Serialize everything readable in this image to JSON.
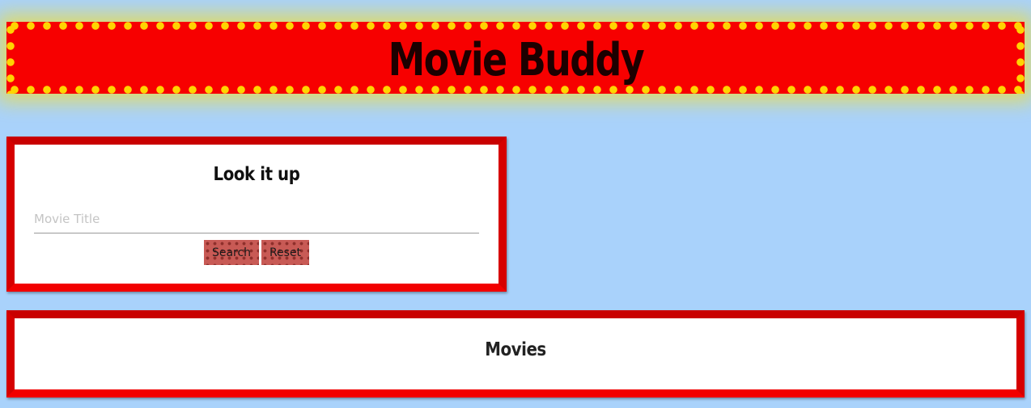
{
  "header": {
    "title": "Movie Buddy"
  },
  "search": {
    "heading": "Look it up",
    "placeholder": "Movie Title",
    "value": "",
    "search_label": "Search",
    "reset_label": "Reset"
  },
  "movies": {
    "heading": "Movies"
  },
  "colors": {
    "background": "#a9d2fb",
    "marquee_red": "#f70000",
    "marquee_lights": "#ffd400",
    "frame_red": "#e40000",
    "button_red": "#c85a55"
  }
}
